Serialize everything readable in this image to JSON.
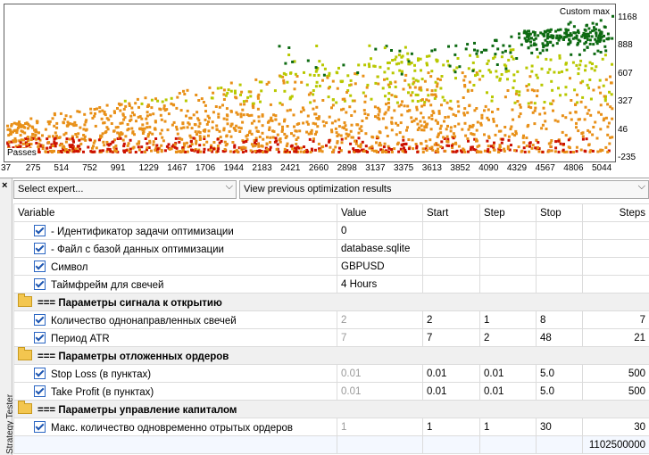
{
  "chart": {
    "title": "Custom max",
    "passes_label": "Passes",
    "y_ticks": [
      "1168",
      "888",
      "607",
      "327",
      "46",
      "-235"
    ],
    "x_ticks": [
      "37",
      "275",
      "514",
      "752",
      "991",
      "1229",
      "1467",
      "1706",
      "1944",
      "2183",
      "2421",
      "2660",
      "2898",
      "3137",
      "3375",
      "3613",
      "3852",
      "4090",
      "4329",
      "4567",
      "4806",
      "5044"
    ],
    "colors": {
      "low": "#cc1100",
      "mid": "#e89018",
      "high": "#b8c800",
      "top": "#0d6a12"
    }
  },
  "chart_data": {
    "type": "scatter",
    "title": "Custom max",
    "xlabel": "Passes",
    "ylabel": "",
    "xlim": [
      37,
      5044
    ],
    "ylim": [
      -235,
      1168
    ],
    "x_ticks": [
      37,
      275,
      514,
      752,
      991,
      1229,
      1467,
      1706,
      1944,
      2183,
      2421,
      2660,
      2898,
      3137,
      3375,
      3613,
      3852,
      4090,
      4329,
      4567,
      4806,
      5044
    ],
    "y_ticks": [
      1168,
      888,
      607,
      327,
      46,
      -235
    ],
    "grid": false
  },
  "left_panel": {
    "close": "×",
    "tab_label": "Strategy Tester"
  },
  "toolbar": {
    "expert_select": "Select expert...",
    "results_select": "View previous optimization results"
  },
  "table": {
    "headers": [
      "Variable",
      "Value",
      "Start",
      "Step",
      "Stop",
      "Steps"
    ],
    "rows": [
      {
        "type": "param",
        "name": "- Идентификатор задачи оптимизации",
        "value": "0",
        "start": "",
        "step": "",
        "stop": "",
        "steps": ""
      },
      {
        "type": "param",
        "name": "- Файл с базой данных оптимизации",
        "value": "database.sqlite",
        "start": "",
        "step": "",
        "stop": "",
        "steps": ""
      },
      {
        "type": "param",
        "name": "Символ",
        "value": "GBPUSD",
        "start": "",
        "step": "",
        "stop": "",
        "steps": ""
      },
      {
        "type": "param",
        "name": "Таймфрейм для свечей",
        "value": "4 Hours",
        "start": "",
        "step": "",
        "stop": "",
        "steps": ""
      },
      {
        "type": "group",
        "name": "=== Параметры сигнала к открытию"
      },
      {
        "type": "param",
        "name": "Количество однонаправленных свечей",
        "value": "2",
        "dim": true,
        "start": "2",
        "step": "1",
        "stop": "8",
        "steps": "7"
      },
      {
        "type": "param",
        "name": "Период ATR",
        "value": "7",
        "dim": true,
        "start": "7",
        "step": "2",
        "stop": "48",
        "steps": "21"
      },
      {
        "type": "group",
        "name": "=== Параметры отложенных ордеров"
      },
      {
        "type": "param",
        "name": "Stop Loss (в пунктах)",
        "value": "0.01",
        "dim": true,
        "start": "0.01",
        "step": "0.01",
        "stop": "5.0",
        "steps": "500"
      },
      {
        "type": "param",
        "name": "Take Profit (в пунктах)",
        "value": "0.01",
        "dim": true,
        "start": "0.01",
        "step": "0.01",
        "stop": "5.0",
        "steps": "500"
      },
      {
        "type": "group",
        "name": "=== Параметры управление капиталом"
      },
      {
        "type": "param",
        "name": "Макс. количество одновременно отрытых ордеров",
        "value": "1",
        "dim": true,
        "start": "1",
        "step": "1",
        "stop": "30",
        "steps": "30"
      }
    ],
    "total_steps": "1102500000"
  }
}
